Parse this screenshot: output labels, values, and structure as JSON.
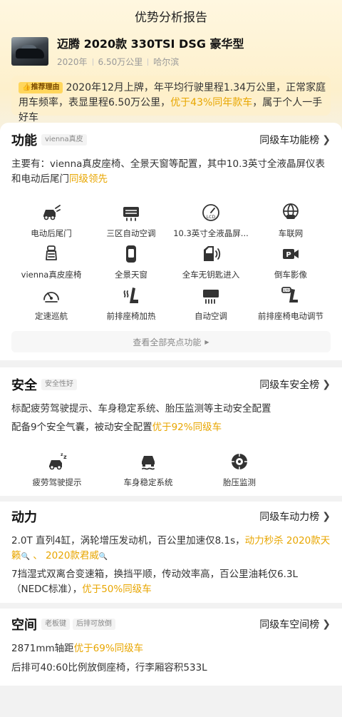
{
  "header": {
    "title": "优势分析报告"
  },
  "car": {
    "title": "迈腾 2020款 330TSI DSG 豪华型",
    "year": "2020年",
    "mileage": "6.50万公里",
    "city": "哈尔滨"
  },
  "reason": {
    "badge": "推荐理由",
    "text_a": "2020年12月上牌，年平均行驶里程1.34万公里，正常家庭用车频率，表显里程6.50万公里，",
    "highlight": "优于43%同年款车",
    "text_b": "，属于个人一手好车"
  },
  "function": {
    "title": "功能",
    "tag": "vienna真皮",
    "rank": "同级车功能榜",
    "desc_a": "主要有：vienna真皮座椅、全景天窗等配置，其中10.3英寸全液晶屏仪表和电动后尾门",
    "desc_hl": "同级领先",
    "features": [
      {
        "label": "电动后尾门",
        "icon": "power-tailgate-icon"
      },
      {
        "label": "三区自动空调",
        "icon": "tri-zone-ac-icon"
      },
      {
        "label": "10.3英寸全液晶屏...",
        "icon": "lcd-dashboard-icon"
      },
      {
        "label": "车联网",
        "icon": "connected-car-icon"
      },
      {
        "label": "vienna真皮座椅",
        "icon": "leather-seat-icon"
      },
      {
        "label": "全景天窗",
        "icon": "panoramic-sunroof-icon"
      },
      {
        "label": "全车无钥匙进入",
        "icon": "keyless-entry-icon"
      },
      {
        "label": "倒车影像",
        "icon": "rear-camera-icon"
      },
      {
        "label": "定速巡航",
        "icon": "cruise-control-icon"
      },
      {
        "label": "前排座椅加热",
        "icon": "seat-heating-icon"
      },
      {
        "label": "自动空调",
        "icon": "auto-ac-icon"
      },
      {
        "label": "前排座椅电动调节",
        "icon": "power-seat-icon"
      }
    ],
    "more": "查看全部亮点功能"
  },
  "safety": {
    "title": "安全",
    "tag": "安全性好",
    "rank": "同级车安全榜",
    "line1": "标配疲劳驾驶提示、车身稳定系统、胎压监测等主动安全配置",
    "line2_a": "配备9个安全气囊，被动安全配置",
    "line2_hl": "优于92%同级车",
    "features": [
      {
        "label": "疲劳驾驶提示",
        "icon": "fatigue-alert-icon"
      },
      {
        "label": "车身稳定系统",
        "icon": "stability-control-icon"
      },
      {
        "label": "胎压监测",
        "icon": "tire-pressure-icon"
      }
    ]
  },
  "power": {
    "title": "动力",
    "rank": "同级车动力榜",
    "line1_a": "2.0T 直列4缸，涡轮增压发动机，百公里加速仅8.1s，",
    "line1_hl": "动力秒杀 2020款天籁",
    "line1_hl2": "2020款君威",
    "line2_a": "7挡湿式双离合变速箱，换挡平顺，传动效率高，百公里油耗仅6.3L（NEDC标准），",
    "line2_hl": "优于50%同级车"
  },
  "space": {
    "title": "空间",
    "tag1": "老板键",
    "tag2": "后排可放倒",
    "rank": "同级车空间榜",
    "line1_a": "2871mm轴距",
    "line1_hl": "优于69%同级车",
    "line2": "后排可40:60比例放倒座椅，行李厢容积533L"
  },
  "colors": {
    "accent": "#e8a600",
    "badge": "#ffd65c",
    "icon": "#333333"
  }
}
